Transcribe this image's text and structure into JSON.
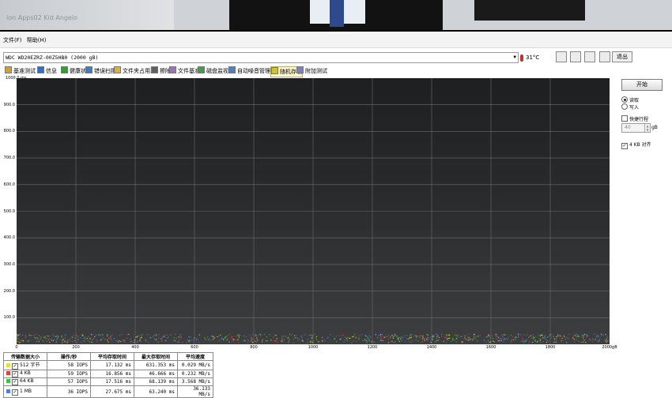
{
  "photo": {
    "watermark": "ion Apps02 Kid Angelo"
  },
  "menu": {
    "file": "文件(F)",
    "help": "帮助(H)"
  },
  "device": {
    "selected": "WDC WD20EZRZ-00Z5HB0 (2000 gB)",
    "temperature": "31°C",
    "exit_label": "退出"
  },
  "tabs": [
    {
      "label": "基准测试",
      "color": "#d8a020"
    },
    {
      "label": "信息",
      "color": "#2f6fd0"
    },
    {
      "label": "健康状态",
      "color": "#30a030"
    },
    {
      "label": "错误扫描",
      "color": "#3080d0"
    },
    {
      "label": "文件夹占用率",
      "color": "#e0b030"
    },
    {
      "label": "擦除",
      "color": "#606060"
    },
    {
      "label": "文件基准",
      "color": "#a070c0"
    },
    {
      "label": "磁盘监视器",
      "color": "#40a040"
    },
    {
      "label": "自动噪音管理",
      "color": "#5080c0"
    },
    {
      "label": "随机存取",
      "color": "#d0c040"
    },
    {
      "label": "附加测试",
      "color": "#8080c0"
    }
  ],
  "side": {
    "start_label": "开始",
    "read_label": "读取",
    "write_label": "写入",
    "quick_stroke_label": "快捷行程",
    "quick_stroke_value": "40",
    "quick_stroke_unit": "gB",
    "align_label": "4 KB 对齐"
  },
  "chart_data": {
    "type": "scatter",
    "xlim": [
      0,
      2000
    ],
    "ylim": [
      0,
      1000
    ],
    "x_ticks": [
      "0",
      "200",
      "400",
      "600",
      "800",
      "1000",
      "1200",
      "1400",
      "1600",
      "1800",
      "2000gB"
    ],
    "y_ticks": [
      "1000.0 ms",
      "900.0",
      "800.0",
      "700.0",
      "600.0",
      "500.0",
      "400.0",
      "300.0",
      "200.0",
      "100.0"
    ],
    "grid": true,
    "series": [
      {
        "name": "512 字节",
        "color": "#e0e040",
        "y_range": [
          8,
          40
        ]
      },
      {
        "name": "4 KB",
        "color": "#e04040",
        "y_range": [
          8,
          40
        ]
      },
      {
        "name": "64 KB",
        "color": "#40c040",
        "y_range": [
          8,
          40
        ]
      },
      {
        "name": "1 MB",
        "color": "#4080f0",
        "y_range": [
          8,
          40
        ]
      }
    ]
  },
  "results": {
    "headers": [
      "传输数据大小",
      "操作/秒",
      "平均存取时间",
      "最大存取时间",
      "平均速度"
    ],
    "rows": [
      {
        "size": "512 字节",
        "color": "#e0e040",
        "ops": "58 IOPS",
        "avg": "17.132 ms",
        "max": "631.353 ms",
        "speed": "0.029 MB/s"
      },
      {
        "size": "4 KB",
        "color": "#e04040",
        "ops": "59 IOPS",
        "avg": "16.856 ms",
        "max": "46.666 ms",
        "speed": "0.232 MB/s"
      },
      {
        "size": "64 KB",
        "color": "#40c040",
        "ops": "57 IOPS",
        "avg": "17.516 ms",
        "max": "68.139 ms",
        "speed": "3.568 MB/s"
      },
      {
        "size": "1 MB",
        "color": "#4080f0",
        "ops": "36 IOPS",
        "avg": "27.675 ms",
        "max": "63.240 ms",
        "speed": "36.133 MB/s"
      }
    ]
  }
}
